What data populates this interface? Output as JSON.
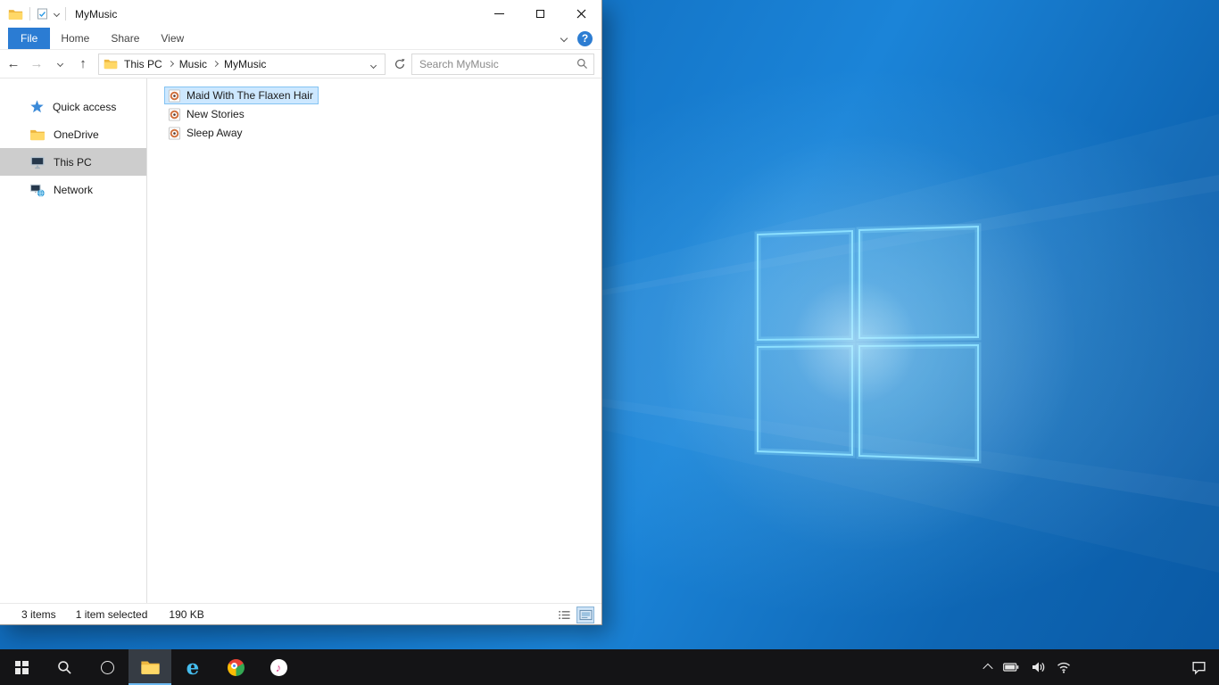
{
  "colors": {
    "accent_blue": "#2b7cd3",
    "file_selection_bg": "#cde8ff",
    "file_selection_border": "#84c3f2",
    "sidebar_selected_bg": "#cdcdcd",
    "taskbar_bg": "#141416",
    "desktop_blue": "#1272c4",
    "logo_line_cyan": "#8ce0ff",
    "folder_yellow": "#ffd867"
  },
  "desktop": {
    "wallpaper": "windows-10-hero-blue-logo"
  },
  "explorer": {
    "title": "MyMusic",
    "ribbon_tabs": [
      {
        "label": "File",
        "active": true
      },
      {
        "label": "Home",
        "active": false
      },
      {
        "label": "Share",
        "active": false
      },
      {
        "label": "View",
        "active": false
      }
    ],
    "help_glyph": "?",
    "nav": {
      "back": "←",
      "forward": "→",
      "up": "↑"
    },
    "breadcrumb": [
      "This PC",
      "Music",
      "MyMusic"
    ],
    "search_placeholder": "Search MyMusic",
    "sidebar_items": [
      {
        "label": "Quick access",
        "icon": "star-icon",
        "selected": false
      },
      {
        "label": "OneDrive",
        "icon": "folder-icon",
        "selected": false
      },
      {
        "label": "This PC",
        "icon": "computer-icon",
        "selected": true
      },
      {
        "label": "Network",
        "icon": "network-icon",
        "selected": false
      }
    ],
    "files": [
      {
        "name": "Maid With The Flaxen Hair",
        "icon": "media-file-icon",
        "selected": true
      },
      {
        "name": "New Stories",
        "icon": "media-file-icon",
        "selected": false
      },
      {
        "name": "Sleep Away",
        "icon": "media-file-icon",
        "selected": false
      }
    ],
    "status": {
      "count": "3 items",
      "selection": "1 item selected",
      "size": "190 KB"
    }
  },
  "taskbar": {
    "ie_glyph": "e",
    "itunes_glyph": "♪",
    "buttons": [
      "start",
      "search",
      "cortana",
      "file-explorer (active)",
      "internet-explorer",
      "chrome",
      "itunes"
    ],
    "tray": [
      "show-hidden-icons",
      "battery",
      "volume",
      "wifi",
      "action-center"
    ]
  }
}
